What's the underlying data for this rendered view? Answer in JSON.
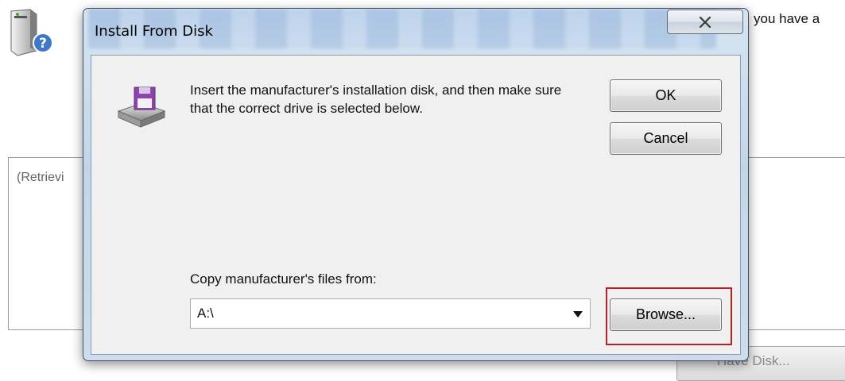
{
  "background": {
    "header_text": "you have a",
    "list_text": "(Retrievi",
    "have_disk_label": "Have Disk..."
  },
  "dialog": {
    "title": "Install From Disk",
    "message": "Insert the manufacturer's installation disk, and then make sure that the correct drive is selected below.",
    "ok_label": "OK",
    "cancel_label": "Cancel",
    "copy_label": "Copy manufacturer's files from:",
    "path_value": "A:\\",
    "browse_label": "Browse..."
  },
  "colors": {
    "highlight": "#b8202a",
    "disk_purple": "#8e44ad",
    "title_bar": "#c3d6e9"
  },
  "icons": [
    "computer-help-icon",
    "close-icon",
    "floppy-drive-icon",
    "chevron-down-icon"
  ]
}
